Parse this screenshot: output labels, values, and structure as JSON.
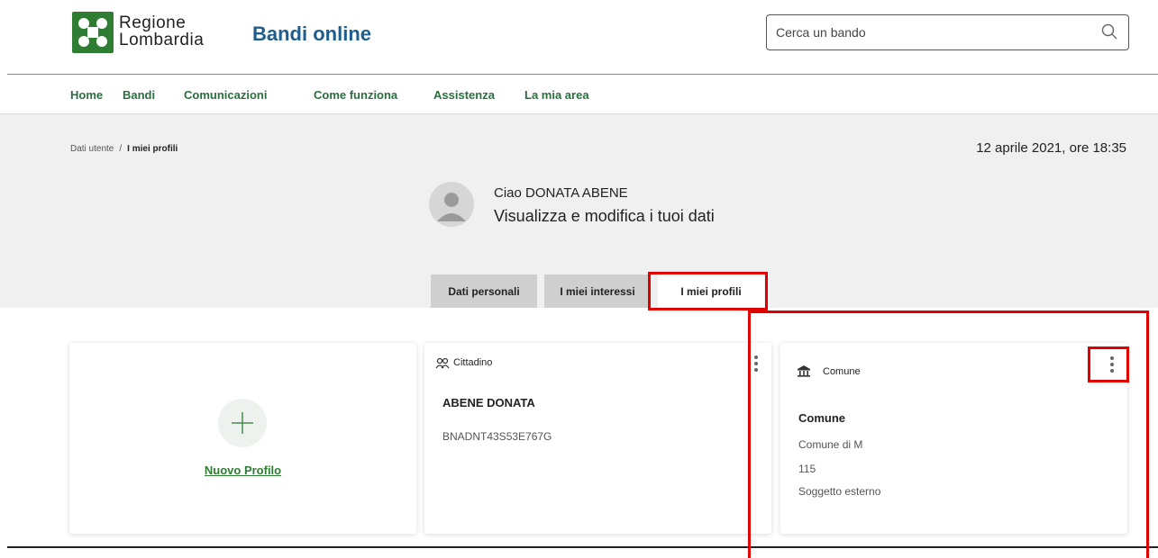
{
  "header": {
    "logo_line1": "Regione",
    "logo_line2": "Lombardia",
    "app_title": "Bandi online",
    "search_placeholder": "Cerca un bando"
  },
  "nav": {
    "items": [
      "Home",
      "Bandi",
      "Comunicazioni",
      "Come funziona",
      "Assistenza",
      "La mia area"
    ]
  },
  "breadcrumb": {
    "parent": "Dati utente",
    "separator": "/",
    "current": "I miei profili"
  },
  "datetime": "12 aprile 2021, ore 18:35",
  "user": {
    "greeting": "Ciao DONATA ABENE",
    "subtitle": "Visualizza e modifica i tuoi dati"
  },
  "tabs": [
    {
      "label": "Dati personali",
      "active": false
    },
    {
      "label": "I miei interessi",
      "active": false
    },
    {
      "label": "I miei profili",
      "active": true
    }
  ],
  "cards": {
    "new_profile": {
      "label": "Nuovo Profilo",
      "icon": "plus-icon"
    },
    "cittadino": {
      "type": "Cittadino",
      "icon": "people-icon",
      "name": "ABENE DONATA",
      "fiscal_code": "BNADNT43S53E767G"
    },
    "comune": {
      "type": "Comune",
      "icon": "town-hall-icon",
      "name": "Comune",
      "line1": "Comune di M",
      "line2": "115",
      "line3": "Soggetto esterno"
    }
  },
  "colors": {
    "brand_green": "#2e7d32",
    "nav_green": "#2a6e3f",
    "title_blue": "#1f5d8c",
    "annotation_red": "#e00000",
    "band_grey": "#f0f0f0"
  }
}
